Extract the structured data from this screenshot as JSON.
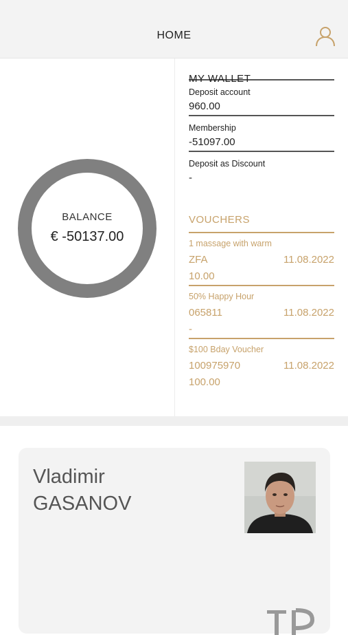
{
  "header": {
    "title": "HOME",
    "profile_icon": "user-icon"
  },
  "balance": {
    "label": "BALANCE",
    "amount": "€ -50137.00"
  },
  "wallet": {
    "title": "MY WALLET",
    "items": [
      {
        "label": "Deposit account",
        "value": "960.00"
      },
      {
        "label": "Membership",
        "value": "-51097.00"
      },
      {
        "label": "Deposit as Discount",
        "value": "-"
      }
    ]
  },
  "vouchers": {
    "title": "VOUCHERS",
    "items": [
      {
        "name": "1 massage with warm",
        "code": "ZFA",
        "date": "11.08.2022",
        "amount": "10.00"
      },
      {
        "name": "50% Happy Hour",
        "code": "065811",
        "date": "11.08.2022",
        "amount": "-"
      },
      {
        "name": "$100 Bday Voucher",
        "code": "100975970",
        "date": "11.08.2022",
        "amount": "100.00"
      }
    ]
  },
  "member_card": {
    "first_name": "Vladimir",
    "last_name": "GASANOV"
  },
  "colors": {
    "accent_gold": "#c7a26b",
    "ring_gray": "#808080",
    "card_bg": "#f3f3f3"
  }
}
